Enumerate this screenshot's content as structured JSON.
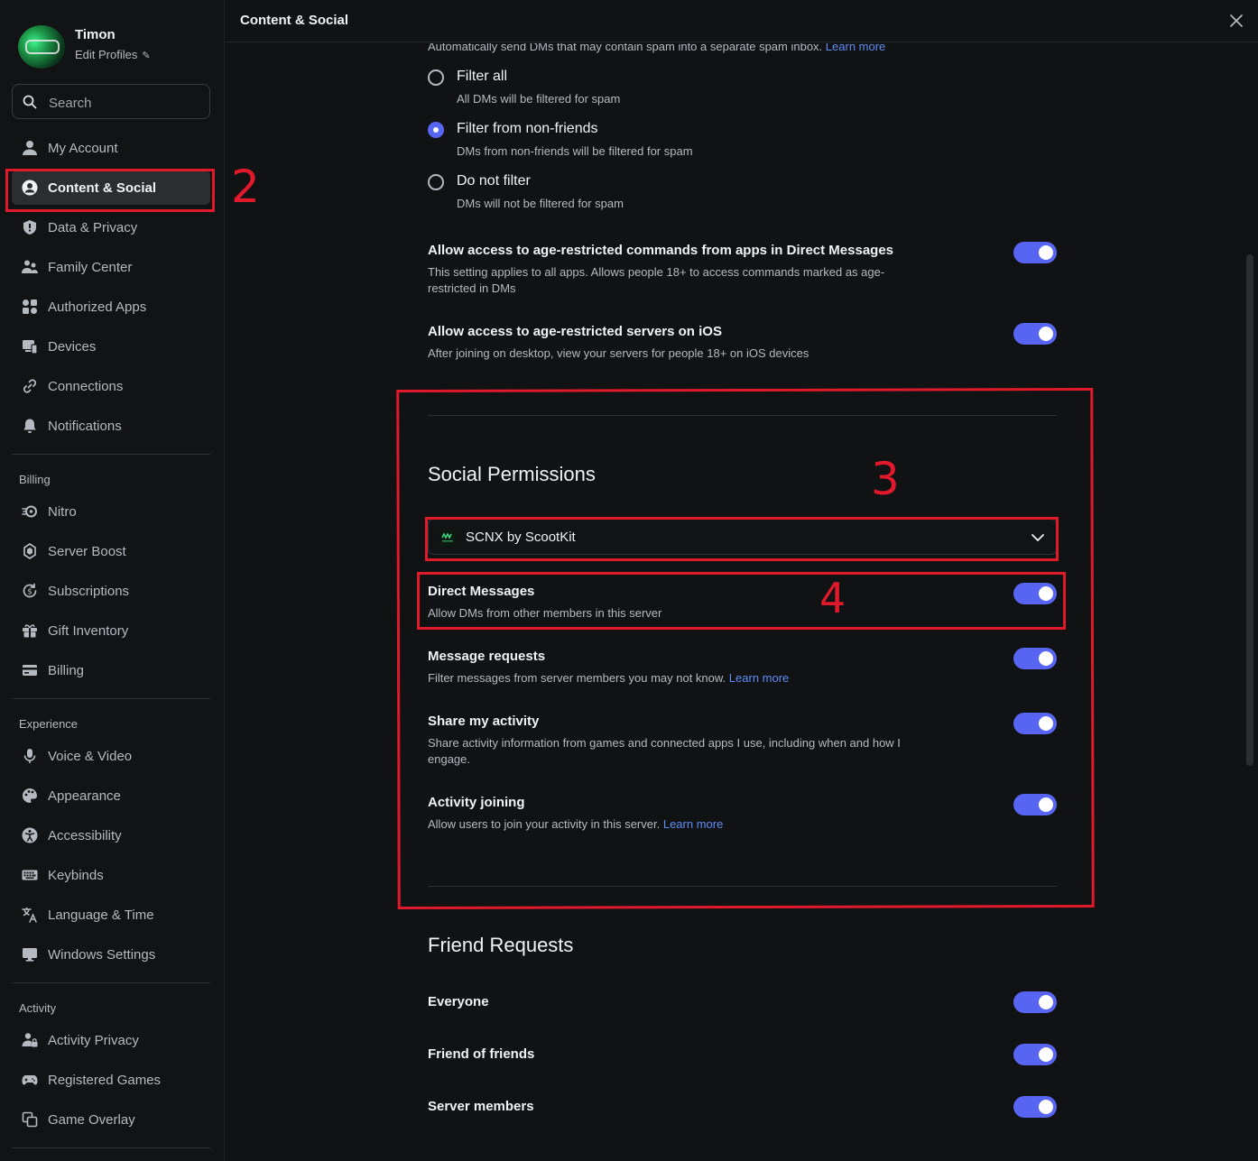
{
  "window": {
    "title": "Content & Social"
  },
  "profile": {
    "name": "Timon",
    "edit_label": "Edit Profiles"
  },
  "search": {
    "placeholder": "Search"
  },
  "sidebar": {
    "user_items": [
      {
        "label": "My Account",
        "icon": "person-icon"
      },
      {
        "label": "Content & Social",
        "icon": "content-social-icon",
        "active": true
      },
      {
        "label": "Data & Privacy",
        "icon": "shield-icon"
      },
      {
        "label": "Family Center",
        "icon": "family-icon"
      },
      {
        "label": "Authorized Apps",
        "icon": "apps-icon"
      },
      {
        "label": "Devices",
        "icon": "devices-icon"
      },
      {
        "label": "Connections",
        "icon": "link-icon"
      },
      {
        "label": "Notifications",
        "icon": "bell-icon"
      }
    ],
    "billing_label": "Billing",
    "billing_items": [
      {
        "label": "Nitro",
        "icon": "nitro-icon"
      },
      {
        "label": "Server Boost",
        "icon": "boost-icon"
      },
      {
        "label": "Subscriptions",
        "icon": "subscriptions-icon"
      },
      {
        "label": "Gift Inventory",
        "icon": "gift-icon"
      },
      {
        "label": "Billing",
        "icon": "card-icon"
      }
    ],
    "experience_label": "Experience",
    "experience_items": [
      {
        "label": "Voice & Video",
        "icon": "microphone-icon"
      },
      {
        "label": "Appearance",
        "icon": "palette-icon"
      },
      {
        "label": "Accessibility",
        "icon": "accessibility-icon"
      },
      {
        "label": "Keybinds",
        "icon": "keyboard-icon"
      },
      {
        "label": "Language & Time",
        "icon": "language-icon"
      },
      {
        "label": "Windows Settings",
        "icon": "monitor-icon"
      }
    ],
    "activity_label": "Activity",
    "activity_items": [
      {
        "label": "Activity Privacy",
        "icon": "activity-privacy-icon"
      },
      {
        "label": "Registered Games",
        "icon": "gamepad-icon"
      },
      {
        "label": "Game Overlay",
        "icon": "overlay-icon"
      }
    ]
  },
  "dm_spam": {
    "intro": "Automatically send DMs that may contain spam into a separate spam inbox.",
    "intro_link": "Learn more",
    "options": [
      {
        "label": "Filter all",
        "desc": "All DMs will be filtered for spam",
        "selected": false
      },
      {
        "label": "Filter from non-friends",
        "desc": "DMs from non-friends will be filtered for spam",
        "selected": true
      },
      {
        "label": "Do not filter",
        "desc": "DMs will not be filtered for spam",
        "selected": false
      }
    ]
  },
  "age_settings": [
    {
      "title": "Allow access to age-restricted commands from apps in Direct Messages",
      "desc": "This setting applies to all apps. Allows people 18+ to access commands marked as age-restricted in DMs",
      "enabled": true
    },
    {
      "title": "Allow access to age-restricted servers on iOS",
      "desc": "After joining on desktop, view your servers for people 18+ on iOS devices",
      "enabled": true
    }
  ],
  "social_permissions": {
    "title": "Social Permissions",
    "server": "SCNX by ScootKit",
    "settings": [
      {
        "title": "Direct Messages",
        "desc": "Allow DMs from other members in this server",
        "link": "",
        "enabled": true
      },
      {
        "title": "Message requests",
        "desc": "Filter messages from server members you may not know.",
        "link": "Learn more",
        "enabled": true
      },
      {
        "title": "Share my activity",
        "desc": "Share activity information from games and connected apps I use, including when and how I engage.",
        "link": "",
        "enabled": true
      },
      {
        "title": "Activity joining",
        "desc": "Allow users to join your activity in this server.",
        "link": "Learn more",
        "enabled": true
      }
    ]
  },
  "friend_requests": {
    "title": "Friend Requests",
    "settings": [
      {
        "title": "Everyone",
        "enabled": true
      },
      {
        "title": "Friend of friends",
        "enabled": true
      },
      {
        "title": "Server members",
        "enabled": true
      }
    ]
  },
  "annotations": [
    "2",
    "3",
    "4"
  ],
  "colors": {
    "accent": "#5865f2",
    "annotation": "#e0192b",
    "link": "#5f8df5",
    "background": "#111214"
  }
}
